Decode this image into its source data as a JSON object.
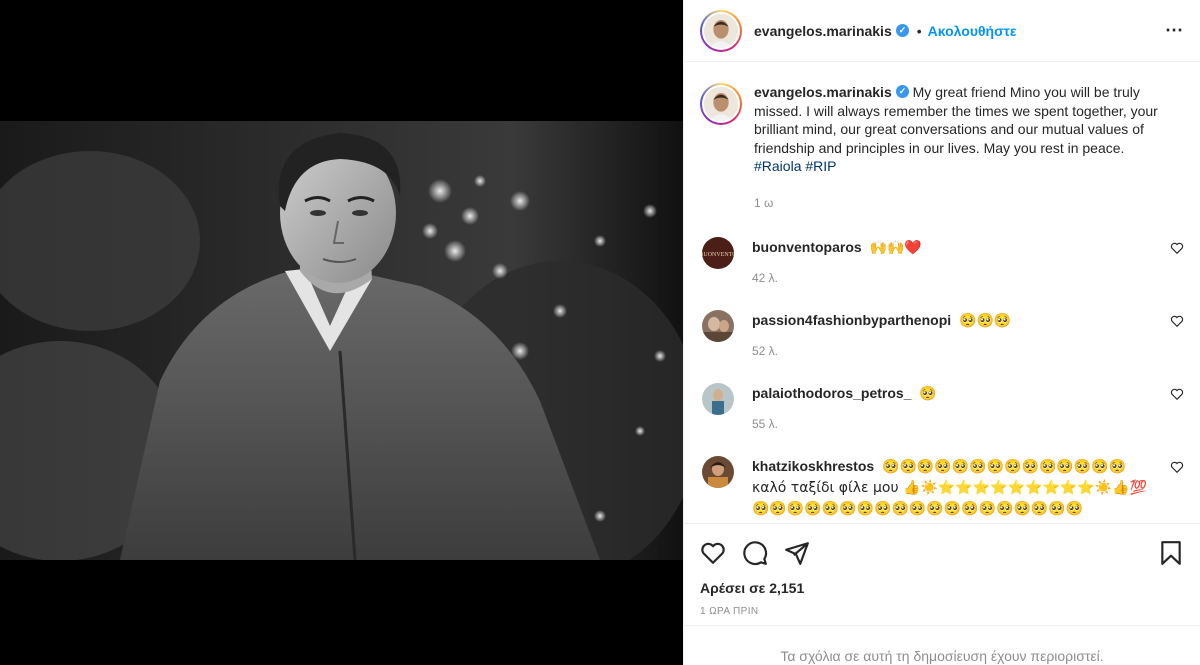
{
  "post": {
    "username": "evangelos.marinakis",
    "follow_label": "Ακολουθήστε",
    "more_icon": "⋯",
    "separator": "•",
    "caption": "My great friend Mino you will be truly missed. I will always remember the times we spent together, your brilliant mind, our great conversations and our mutual values of friendship and principles in our lives. May you rest in peace.",
    "hashtags": [
      "#Raiola",
      "#RIP"
    ],
    "caption_age": "1 ω",
    "likes_label": "Αρέσει σε 2,151",
    "time_label": "1 ΩΡΑ ΠΡΙΝ",
    "comments_restricted": "Τα σχόλια σε αυτή τη δημοσίευση έχουν περιοριστεί."
  },
  "comments": [
    {
      "username": "buonventoparos",
      "text": "🙌🙌❤️",
      "age": "42 λ."
    },
    {
      "username": "passion4fashionbyparthenopi",
      "text": "🥺🥺🥺",
      "age": "52 λ."
    },
    {
      "username": "palaiothodoros_petros_",
      "text": "🥺",
      "age": "55 λ."
    },
    {
      "username": "khatzikoskhrestos",
      "text": "🥺🥺🥺🥺🥺🥺🥺🥺🥺🥺🥺🥺🥺🥺 καλό ταξίδι φίλε μου 👍☀️⭐⭐⭐⭐⭐⭐⭐⭐⭐☀️👍💯 🥺🥺🥺🥺🥺🥺🥺🥺🥺🥺🥺🥺🥺🥺🥺🥺🥺🥺🥺",
      "age": ""
    }
  ],
  "colors": {
    "link": "#0095f6",
    "hashtag": "#00376b",
    "muted": "#8e8e8e",
    "verified": "#3897f0"
  },
  "icons": {
    "like": "heart-icon",
    "comment": "comment-icon",
    "share": "paper-plane-icon",
    "save": "bookmark-icon"
  }
}
